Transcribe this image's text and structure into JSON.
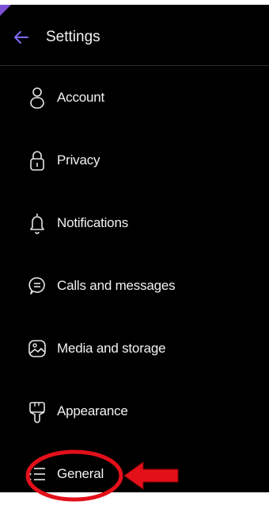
{
  "header": {
    "title": "Settings"
  },
  "menu": [
    {
      "label": "Account",
      "icon": "account-icon"
    },
    {
      "label": "Privacy",
      "icon": "lock-icon"
    },
    {
      "label": "Notifications",
      "icon": "bell-icon"
    },
    {
      "label": "Calls and messages",
      "icon": "chat-bubble-icon"
    },
    {
      "label": "Media and storage",
      "icon": "media-image-icon"
    },
    {
      "label": "Appearance",
      "icon": "paintbrush-icon"
    },
    {
      "label": "General",
      "icon": "general-list-icon"
    }
  ],
  "colors": {
    "background": "#000000",
    "text": "#f2f2f2",
    "accent": "#7b6cf6",
    "annotation": "#e3101a"
  }
}
